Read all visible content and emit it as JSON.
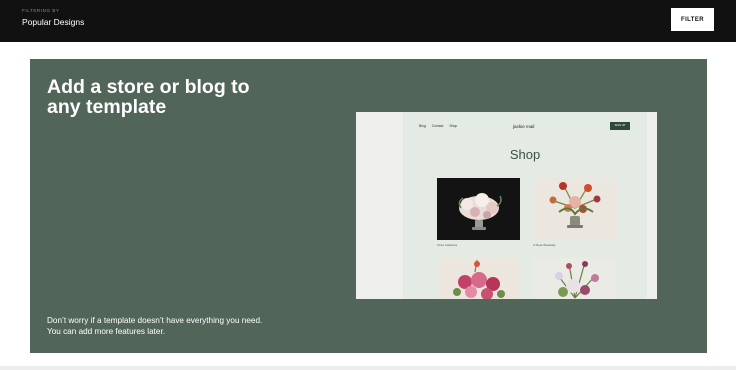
{
  "header": {
    "filter_caption": "FILTERING BY",
    "filter_value": "Popular Designs",
    "filter_button": "FILTER"
  },
  "promo": {
    "title": "Add a store or blog to any template",
    "description_line1": "Don’t worry if a template doesn’t have everything you need.",
    "description_line2": "You can add more features later.",
    "background_color": "#526559"
  },
  "preview": {
    "nav_items": [
      "Blog",
      "Contact",
      "Shop"
    ],
    "logo": "jackie mail",
    "signup_label": "SIGN UP",
    "heading": "Shop",
    "products": [
      {
        "caption": "Chez Cafeteria"
      },
      {
        "caption": "A Fleet Weekday"
      }
    ]
  }
}
